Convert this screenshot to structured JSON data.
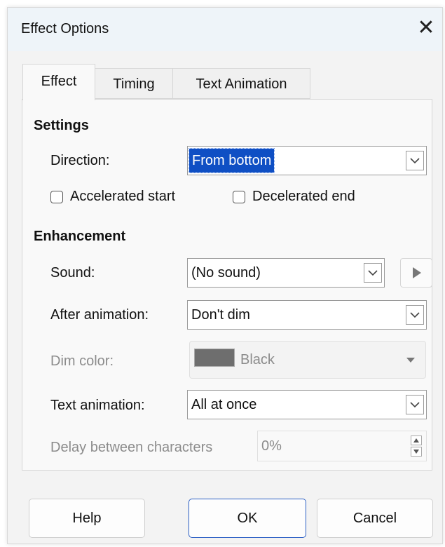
{
  "window": {
    "title": "Effect Options"
  },
  "tabs": [
    {
      "label": "Effect",
      "active": true
    },
    {
      "label": "Timing",
      "active": false
    },
    {
      "label": "Text Animation",
      "active": false
    }
  ],
  "settings": {
    "heading": "Settings",
    "direction": {
      "label": "Direction:",
      "value": "From bottom"
    },
    "accelerated_start": {
      "label": "Accelerated start",
      "checked": false
    },
    "decelerated_end": {
      "label": "Decelerated end",
      "checked": false
    }
  },
  "enhancement": {
    "heading": "Enhancement",
    "sound": {
      "label": "Sound:",
      "value": "(No sound)"
    },
    "after_animation": {
      "label": "After animation:",
      "value": "Don't dim"
    },
    "dim_color": {
      "label": "Dim color:",
      "value": "Black",
      "color": "#6e6e6e",
      "enabled": false
    },
    "text_animation": {
      "label": "Text animation:",
      "value": "All at once"
    },
    "delay": {
      "label": "Delay between characters",
      "value": "0%",
      "enabled": false
    }
  },
  "buttons": {
    "help": "Help",
    "ok": "OK",
    "cancel": "Cancel"
  },
  "colors": {
    "selection": "#0f4fc4",
    "default_button_border": "#2b5fc4"
  },
  "icons": [
    "close-icon",
    "chevron-down-icon",
    "play-icon",
    "spin-up-icon",
    "spin-down-icon",
    "dropdown-triangle-icon"
  ]
}
